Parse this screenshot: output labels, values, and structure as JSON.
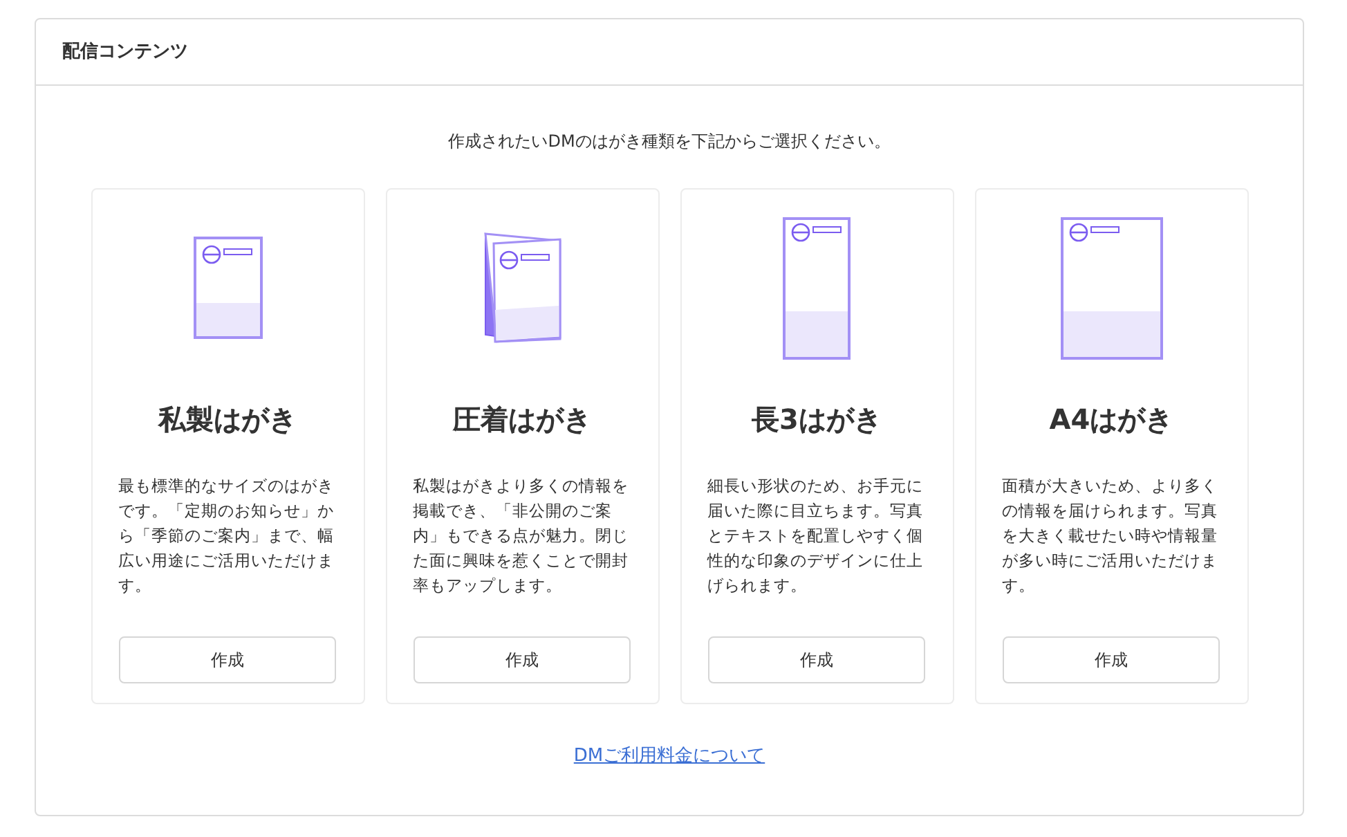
{
  "panel": {
    "title": "配信コンテンツ"
  },
  "intro": "作成されたいDMのはがき種類を下記からご選択ください。",
  "cards": [
    {
      "kind": "postcard",
      "title": "私製はがき",
      "description": "最も標準的なサイズのはがきです。「定期のお知らせ」から「季節のご案内」まで、幅広い用途にご活用いただけます。",
      "button": "作成"
    },
    {
      "kind": "folded",
      "title": "圧着はがき",
      "description": "私製はがきより多くの情報を掲載でき、「非公開のご案内」もできる点が魅力。閉じた面に興味を惹くことで開封率もアップします。",
      "button": "作成"
    },
    {
      "kind": "tall",
      "title": "長3はがき",
      "description": "細長い形状のため、お手元に届いた際に目立ちます。写真とテキストを配置しやすく個性的な印象のデザインに仕上げられます。",
      "button": "作成"
    },
    {
      "kind": "a4",
      "title": "A4はがき",
      "description": "面積が大きいため、より多くの情報を届けられます。写真を大きく載せたい時や情報量が多い時にご活用いただけます。",
      "button": "作成"
    }
  ],
  "link": "DMご利用料金について"
}
